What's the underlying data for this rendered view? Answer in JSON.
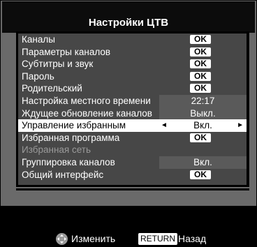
{
  "title": "Настройки ЦТВ",
  "items": [
    {
      "label": "Каналы",
      "value": "OK",
      "kind": "button"
    },
    {
      "label": "Параметры каналов",
      "value": "OK",
      "kind": "button"
    },
    {
      "label": "Субтитры и звук",
      "value": "OK",
      "kind": "button"
    },
    {
      "label": "Пароль",
      "value": "OK",
      "kind": "button"
    },
    {
      "label": "Родительский",
      "value": "OK",
      "kind": "button"
    },
    {
      "label": "Настройка местного времени",
      "value": "22:17",
      "kind": "value"
    },
    {
      "label": "Ждущее обновление каналов",
      "value": "Выкл.",
      "kind": "value"
    },
    {
      "label": "Управление избранным",
      "value": "Вкл.",
      "kind": "selector",
      "selected": true
    },
    {
      "label": "Избранная программа",
      "value": "OK",
      "kind": "button"
    },
    {
      "label": "Избранная сеть",
      "value": "",
      "kind": "disabled"
    },
    {
      "label": "Группировка каналов",
      "value": "Вкл.",
      "kind": "value"
    },
    {
      "label": "Общий интерфейс",
      "value": "OK",
      "kind": "button"
    }
  ],
  "footer": {
    "change_label": "Изменить",
    "return_key": "RETURN",
    "back_label": "Назад"
  },
  "colors": {
    "background": "#000000",
    "panel": "#6a6a6a",
    "list": "#474747",
    "selected_row": "#ffffff"
  }
}
